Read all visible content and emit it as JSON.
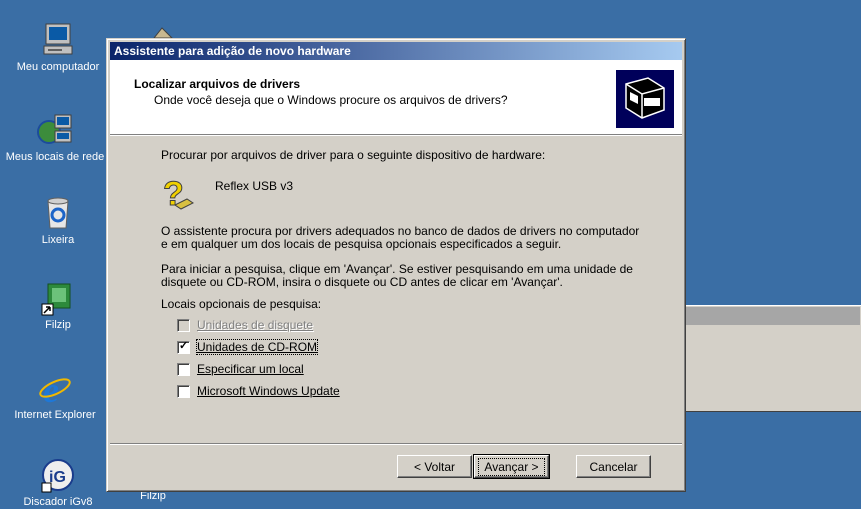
{
  "desktop": {
    "icons": [
      {
        "label": "Meu computador",
        "icon": "my-computer-icon"
      },
      {
        "label": "Meus locais de rede",
        "icon": "network-places-icon"
      },
      {
        "label": "Lixeira",
        "icon": "recycle-bin-icon"
      },
      {
        "label": "Filzip",
        "icon": "filzip-icon"
      },
      {
        "label": "Internet Explorer",
        "icon": "internet-explorer-icon"
      },
      {
        "label": "Discador iGv8",
        "icon": "igv8-dialer-icon"
      },
      {
        "label": "Filzip",
        "icon": "filzip-icon"
      }
    ]
  },
  "dialog": {
    "title": "Assistente para adição de novo hardware",
    "header_title": "Localizar arquivos de drivers",
    "header_subtitle": "Onde você deseja que o Windows procure os arquivos de drivers?",
    "intro": "Procurar por arquivos de driver para o seguinte dispositivo de hardware:",
    "device_name": "Reflex USB v3",
    "para1_line1": "O assistente procura por drivers adequados no banco de dados de drivers no computador",
    "para1_line2": "e em qualquer um dos locais de pesquisa opcionais especificados a seguir.",
    "para2_line1": "Para iniciar a pesquisa, clique em 'Avançar'. Se estiver pesquisando em uma unidade de",
    "para2_line2": "disquete ou CD-ROM, insira o disquete ou CD antes de clicar em 'Avançar'.",
    "options_label": "Locais opcionais de pesquisa:",
    "options": [
      {
        "label": "Unidades de disquete",
        "checked": false,
        "enabled": false
      },
      {
        "label": "Unidades de CD-ROM",
        "checked": true,
        "enabled": true
      },
      {
        "label": "Especificar um local",
        "checked": false,
        "enabled": true
      },
      {
        "label": "Microsoft Windows Update",
        "checked": false,
        "enabled": true
      }
    ],
    "buttons": {
      "back": "< Voltar",
      "next": "Avançar >",
      "cancel": "Cancelar"
    }
  }
}
